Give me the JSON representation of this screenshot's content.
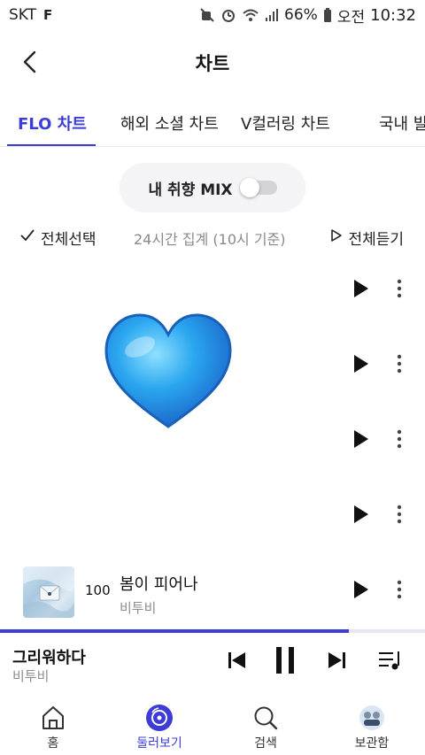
{
  "status_bar": {
    "carrier": "SKT",
    "carrier_badge": "F",
    "battery": "66%",
    "ampm": "오전",
    "time": "10:32",
    "icons": [
      "mute-icon",
      "alarm-icon",
      "wifi-icon",
      "signal-icon",
      "battery-icon"
    ]
  },
  "header": {
    "title": "차트",
    "back_icon": "chevron-left-icon"
  },
  "tabs": [
    {
      "label": "FLO 차트",
      "active": true
    },
    {
      "label": "해외 소셜 차트",
      "active": false
    },
    {
      "label": "V컬러링 차트",
      "active": false
    },
    {
      "label": "국내 발",
      "active": false
    }
  ],
  "mix": {
    "label": "내 취향 MIX",
    "toggle_on": false
  },
  "controls": {
    "select_all": "전체선택",
    "aggregation": "24시간 집계 (10시 기준)",
    "play_all": "전체듣기"
  },
  "overlay": {
    "icon": "blue-heart-icon",
    "color": "#2aa6ef"
  },
  "chart_rows": [
    {
      "rank": "",
      "title": "",
      "artist": ""
    },
    {
      "rank": "",
      "title": "",
      "artist": ""
    },
    {
      "rank": "",
      "title": "",
      "artist": ""
    },
    {
      "rank": "",
      "title": "",
      "artist": ""
    },
    {
      "rank": "100",
      "title": "봄이 피어나",
      "artist": "비투비"
    }
  ],
  "now_playing": {
    "title": "그리워하다",
    "artist": "비투비",
    "progress": 0.82
  },
  "bottom_nav": [
    {
      "label": "홈",
      "icon": "home-icon",
      "active": false
    },
    {
      "label": "둘러보기",
      "icon": "browse-disc-icon",
      "active": true
    },
    {
      "label": "검색",
      "icon": "search-icon",
      "active": false
    },
    {
      "label": "보관함",
      "icon": "library-avatar-icon",
      "active": false
    }
  ],
  "colors": {
    "accent": "#3d3cd6",
    "muted_text": "#8d8d8d"
  }
}
